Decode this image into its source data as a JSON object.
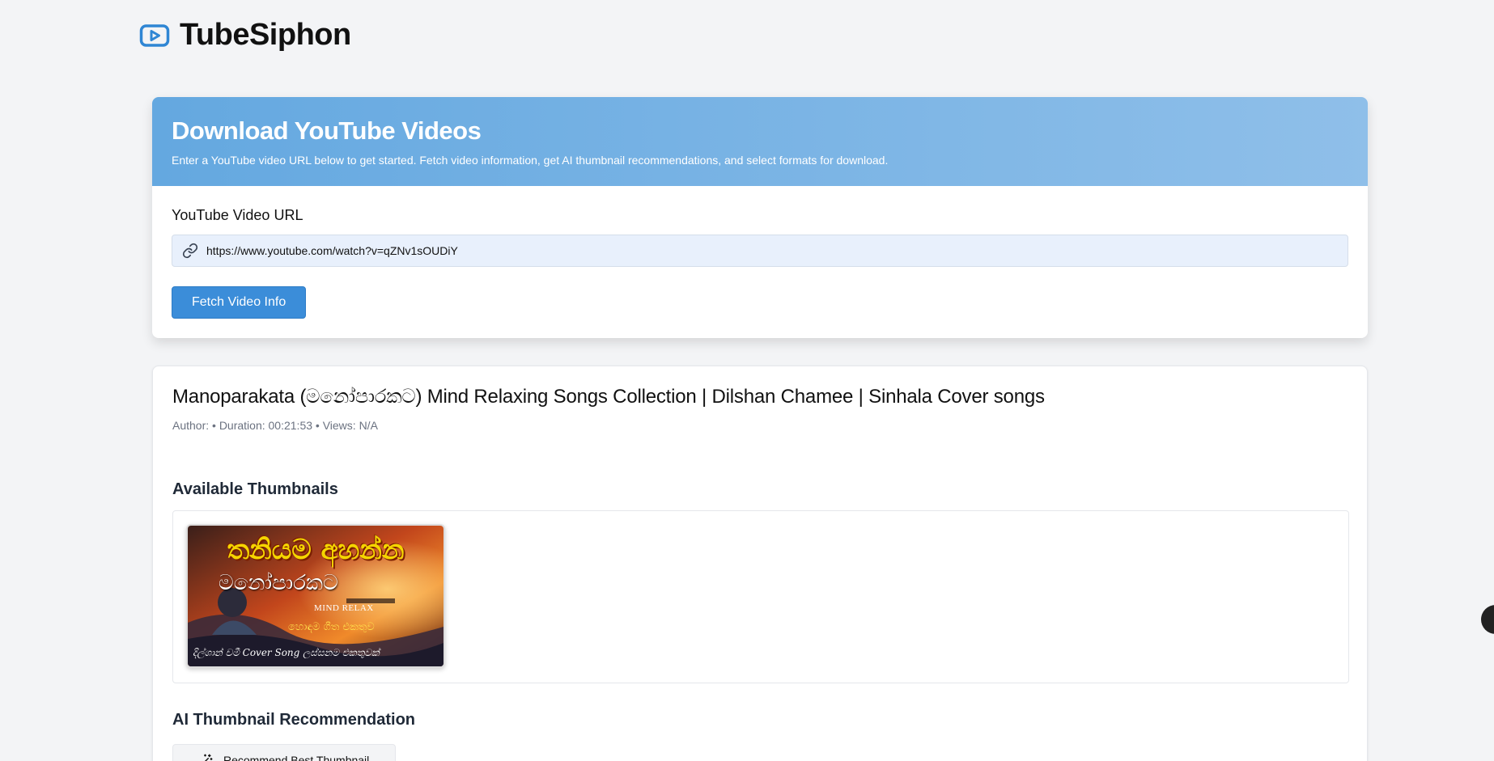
{
  "app": {
    "brand": "TubeSiphon",
    "logo_icon": "play-square-icon"
  },
  "hero": {
    "title": "Download YouTube Videos",
    "subtitle": "Enter a YouTube video URL below to get started. Fetch video information, get AI thumbnail recommendations, and select formats for download."
  },
  "form": {
    "url_label": "YouTube Video URL",
    "url_value": "https://www.youtube.com/watch?v=qZNv1sOUDiY",
    "link_icon": "link-icon",
    "fetch_button": "Fetch Video Info"
  },
  "video": {
    "title": "Manoparakata (මනෝපාරකට) Mind Relaxing Songs Collection | Dilshan Chamee | Sinhala Cover songs",
    "meta": "Author: • Duration: 00:21:53 • Views: N/A"
  },
  "thumbnails": {
    "heading": "Available Thumbnails",
    "items": [
      {
        "headline": "තනියම අහන්න",
        "script_title": "මනෝපාරකට",
        "tag": "MIND RELAX",
        "subline": "හොඳම ගීත එකතුව",
        "footer": "දිල්ශාන් චමී Cover Song ලස්සනම එකතුවක්"
      }
    ]
  },
  "ai": {
    "heading": "AI Thumbnail Recommendation",
    "button": "Recommend Best Thumbnail",
    "button_icon": "magic-wand-icon"
  },
  "colors": {
    "accent": "#3b8dd9",
    "hero_start": "#64a8e0",
    "hero_end": "#8fbfe9",
    "background": "#f3f4f6"
  }
}
